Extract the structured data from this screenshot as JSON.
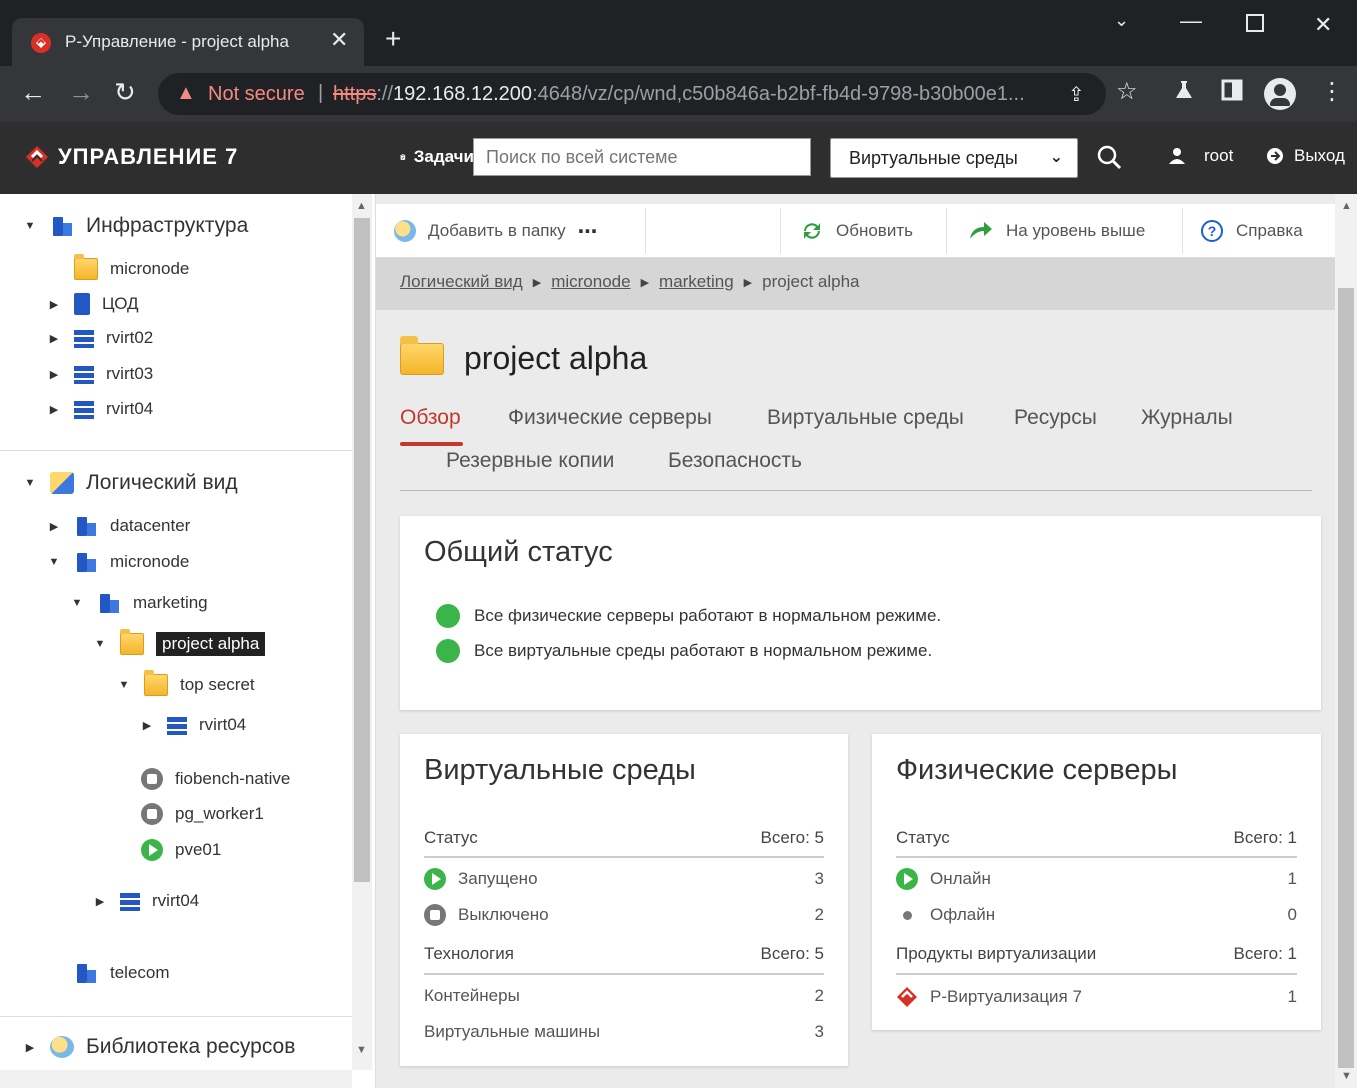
{
  "browser": {
    "tab_title": "Р-Управление - project alpha",
    "tab_close": "✕",
    "new_tab": "+",
    "not_secure": "Not secure",
    "url_scheme": "https",
    "url_rest": "://",
    "url_host": "192.168.12.200",
    "url_path": ":4648/vz/cp/wnd,c50b846a-b2bf-fb4d-9798-b30b00e1..."
  },
  "app": {
    "brand": "УПРАВЛЕНИЕ 7",
    "tasks_label": "Задачи",
    "search_placeholder": "Поиск по всей системе",
    "scope_selected": "Виртуальные среды",
    "user": "root",
    "logout": "Выход"
  },
  "sidebar": {
    "infra": {
      "label": "Инфраструктура",
      "items": [
        "micronode",
        "ЦОД",
        "rvirt02",
        "rvirt03",
        "rvirt04"
      ]
    },
    "logical": {
      "label": "Логический вид",
      "datacenter": "datacenter",
      "micronode": "micronode",
      "marketing": "marketing",
      "project_alpha": "project alpha",
      "top_secret": "top secret",
      "rvirt04_inner": "rvirt04",
      "fiobench": "fiobench-native",
      "pg_worker": "pg_worker1",
      "pve01": "pve01",
      "rvirt04_outer": "rvirt04",
      "telecom": "telecom"
    },
    "library": "Библиотека ресурсов"
  },
  "actions": {
    "add_to_folder": "Добавить в папку",
    "more": "⋯",
    "refresh": "Обновить",
    "up_level": "На уровень выше",
    "help": "Справка"
  },
  "breadcrumb": [
    "Логический вид",
    "micronode",
    "marketing",
    "project alpha"
  ],
  "page": {
    "title": "project alpha",
    "tabs": [
      "Обзор",
      "Физические серверы",
      "Виртуальные среды",
      "Ресурсы",
      "Журналы",
      "Резервные копии",
      "Безопасность"
    ]
  },
  "general_status": {
    "title": "Общий статус",
    "lines": [
      "Все физические серверы работают в нормальном режиме.",
      "Все виртуальные среды работают в нормальном режиме."
    ]
  },
  "ve_card": {
    "title": "Виртуальные среды",
    "status_head": "Статус",
    "status_total": "Всего: 5",
    "running_label": "Запущено",
    "running_value": "3",
    "stopped_label": "Выключено",
    "stopped_value": "2",
    "tech_head": "Технология",
    "tech_total": "Всего: 5",
    "containers_label": "Контейнеры",
    "containers_value": "2",
    "vms_label": "Виртуальные машины",
    "vms_value": "3"
  },
  "ps_card": {
    "title": "Физические серверы",
    "status_head": "Статус",
    "status_total": "Всего: 1",
    "online_label": "Онлайн",
    "online_value": "1",
    "offline_label": "Офлайн",
    "offline_value": "0",
    "products_head": "Продукты виртуализации",
    "products_total": "Всего: 1",
    "product_label": "Р-Виртуализация 7",
    "product_value": "1"
  },
  "colors": {
    "accent": "#c0392b",
    "status_green": "#3bb44a",
    "header_bg": "#2e2e2e",
    "tree_blue": "#2257c4"
  }
}
